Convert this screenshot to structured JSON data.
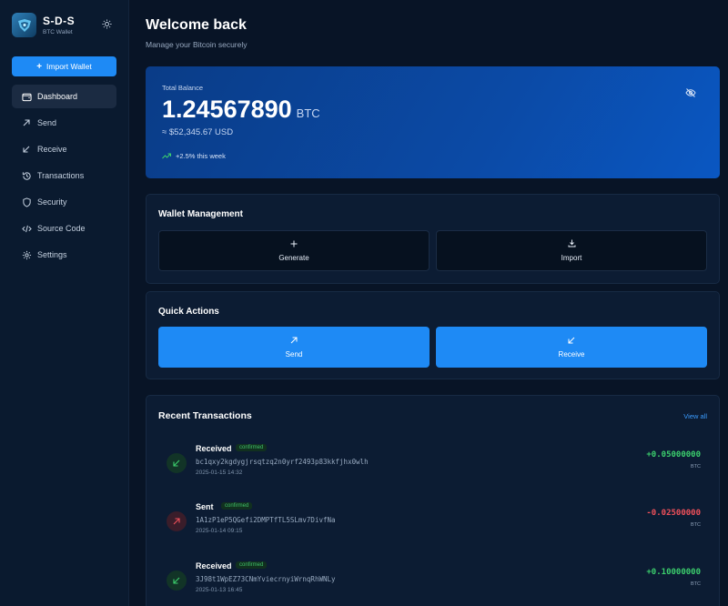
{
  "brand": {
    "name": "S-D-S",
    "subtitle": "BTC Wallet"
  },
  "sidebar": {
    "import_label": "Import Wallet",
    "items": [
      {
        "label": "Dashboard",
        "icon": "wallet-icon",
        "active": true
      },
      {
        "label": "Send",
        "icon": "arrow-up-right-icon"
      },
      {
        "label": "Receive",
        "icon": "arrow-down-left-icon"
      },
      {
        "label": "Transactions",
        "icon": "history-icon"
      },
      {
        "label": "Security",
        "icon": "shield-icon"
      },
      {
        "label": "Source Code",
        "icon": "code-icon"
      },
      {
        "label": "Settings",
        "icon": "gear-icon"
      }
    ]
  },
  "header": {
    "title": "Welcome back",
    "subtitle": "Manage your Bitcoin securely"
  },
  "balance": {
    "label": "Total Balance",
    "amount": "1.24567890",
    "unit": "BTC",
    "usd": "≈ $52,345.67 USD",
    "change": "+2.5% this week"
  },
  "wallet_management": {
    "title": "Wallet Management",
    "generate_label": "Generate",
    "import_label": "Import"
  },
  "quick_actions": {
    "title": "Quick Actions",
    "send_label": "Send",
    "receive_label": "Receive"
  },
  "transactions": {
    "title": "Recent Transactions",
    "view_all": "View all",
    "items": [
      {
        "type": "Received",
        "status": "confirmed",
        "address": "bc1qxy2kgdygjrsqtzq2n0yrf2493p83kkfjhx0wlh",
        "date": "2025-01-15 14:32",
        "amount": "+0.05000000",
        "unit": "BTC"
      },
      {
        "type": "Sent",
        "status": "confirmed",
        "address": "1A1zP1eP5QGefi2DMPTfTL5SLmv7DivfNa",
        "date": "2025-01-14 09:15",
        "amount": "-0.02500000",
        "unit": "BTC"
      },
      {
        "type": "Received",
        "status": "confirmed",
        "address": "3J98t1WpEZ73CNmYviecrnyiWrnqRhWNLy",
        "date": "2025-01-13 16:45",
        "amount": "+0.10000000",
        "unit": "BTC"
      }
    ]
  },
  "colors": {
    "accent": "#1e8af5",
    "positive": "#3ccf6d",
    "negative": "#f0505a",
    "background": "#081426"
  }
}
